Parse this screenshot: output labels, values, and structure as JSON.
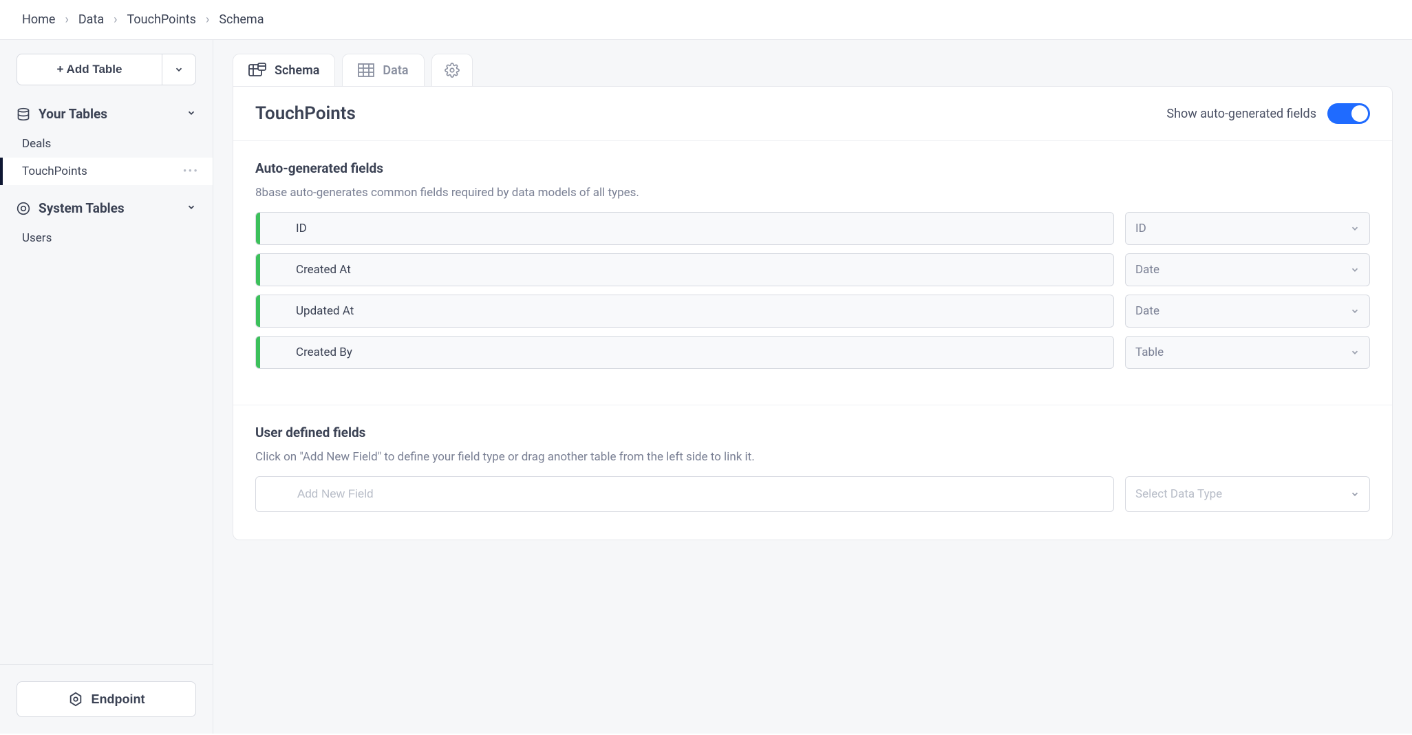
{
  "breadcrumb": [
    "Home",
    "Data",
    "TouchPoints",
    "Schema"
  ],
  "sidebar": {
    "addTable": "+ Add Table",
    "yourTables": "Your Tables",
    "systemTables": "System Tables",
    "tables": [
      "Deals",
      "TouchPoints"
    ],
    "systemTableList": [
      "Users"
    ],
    "endpoint": "Endpoint"
  },
  "tabs": {
    "schema": "Schema",
    "data": "Data"
  },
  "panel": {
    "title": "TouchPoints",
    "toggleLabel": "Show auto-generated fields"
  },
  "autoSection": {
    "heading": "Auto-generated fields",
    "desc": "8base auto-generates common fields required by data models of all types.",
    "fields": [
      {
        "name": "ID",
        "type": "ID"
      },
      {
        "name": "Created At",
        "type": "Date"
      },
      {
        "name": "Updated At",
        "type": "Date"
      },
      {
        "name": "Created By",
        "type": "Table"
      }
    ]
  },
  "userSection": {
    "heading": "User defined fields",
    "desc": "Click on \"Add New Field\" to define your field type or drag another table from the left side to link it.",
    "placeholder": "Add New Field",
    "selectPlaceholder": "Select Data Type"
  }
}
